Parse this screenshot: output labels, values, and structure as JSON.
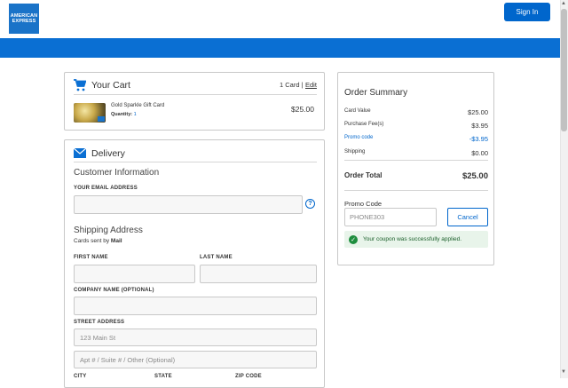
{
  "header": {
    "logo_line1": "AMERICAN",
    "logo_line2": "EXPRESS",
    "signin_label": "Sign In"
  },
  "cart": {
    "title": "Your Cart",
    "count": "1 Card |",
    "edit_label": "Edit",
    "item": {
      "name": "Gold Sparkle Gift Card",
      "quantity_label": "Quantity:",
      "quantity_value": "1",
      "price": "$25.00"
    }
  },
  "delivery": {
    "title": "Delivery",
    "customer_info_title": "Customer Information",
    "email_label": "YOUR EMAIL ADDRESS",
    "email_value": "",
    "help_icon": "?",
    "shipping_title": "Shipping Address",
    "cards_sent_prefix": "Cards sent by",
    "cards_sent_method": "Mail",
    "first_name_label": "FIRST NAME",
    "last_name_label": "LAST NAME",
    "company_label": "COMPANY NAME (OPTIONAL)",
    "street_label": "STREET ADDRESS",
    "street_placeholder": "123 Main St",
    "apt_placeholder": "Apt # / Suite # / Other (Optional)",
    "city_label": "CITY",
    "state_label": "STATE",
    "zip_label": "ZIP CODE"
  },
  "summary": {
    "title": "Order Summary",
    "rows": [
      {
        "label": "Card Value",
        "value": "$25.00"
      },
      {
        "label": "Purchase Fee(s)",
        "value": "$3.95"
      },
      {
        "label": "Promo code",
        "value": "-$3.95"
      },
      {
        "label": "Shipping",
        "value": "$0.00"
      }
    ],
    "total_label": "Order Total",
    "total_value": "$25.00",
    "promo_label": "Promo Code",
    "promo_value": "PHONE303",
    "cancel_label": "Cancel",
    "success_icon": "✓",
    "success_message": "Your coupon was successfully applied."
  },
  "colors": {
    "brand_blue": "#0a6fd3",
    "button_blue": "#0066cc",
    "success_green": "#1e8e3e"
  }
}
